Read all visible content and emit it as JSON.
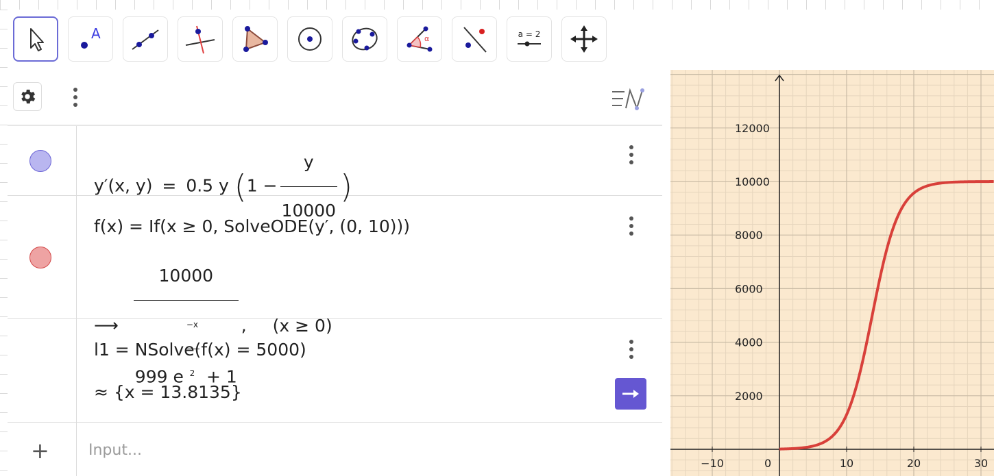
{
  "toolbar": {
    "tools": [
      {
        "name": "move-tool",
        "active": true
      },
      {
        "name": "point-tool",
        "label": "A"
      },
      {
        "name": "line-tool"
      },
      {
        "name": "perpendicular-line-tool"
      },
      {
        "name": "polygon-tool"
      },
      {
        "name": "circle-center-point-tool"
      },
      {
        "name": "conic-five-points-tool"
      },
      {
        "name": "angle-tool",
        "label": "α"
      },
      {
        "name": "reflect-tool"
      },
      {
        "name": "slider-tool",
        "label": "a = 2"
      },
      {
        "name": "move-graphics-view-tool"
      }
    ]
  },
  "algebra": {
    "rows": [
      {
        "color": "#b9b6f0",
        "border": "#6b65d6",
        "lhs": "y′(x, y)",
        "eq": "=",
        "coef": "0.5 y",
        "one": "1 −",
        "num": "y",
        "den": "10000"
      },
      {
        "color": "#eea3a3",
        "border": "#d44b4b",
        "definition": "f(x)  =  If(x ≥ 0, SolveODE(y′, (0, 10)))",
        "arrow": "⟶",
        "num": "10000",
        "den_pre": "999 e",
        "exp_num": "−x",
        "exp_den": "2",
        "den_post": "+ 1",
        "after": ",",
        "cond": "(x ≥ 0)"
      },
      {
        "definition": "l1  =  NSolve(f(x)  =  5000)",
        "result": "≈ {x  =  13.8135}"
      }
    ],
    "input_placeholder": "Input..."
  },
  "graph": {
    "y_ticks": [
      "12000",
      "10000",
      "8000",
      "6000",
      "4000",
      "2000"
    ],
    "x_ticks": [
      "−10",
      "0",
      "10",
      "20",
      "30"
    ],
    "curve_color": "#d8403a",
    "background": "#fbe9cf"
  }
}
